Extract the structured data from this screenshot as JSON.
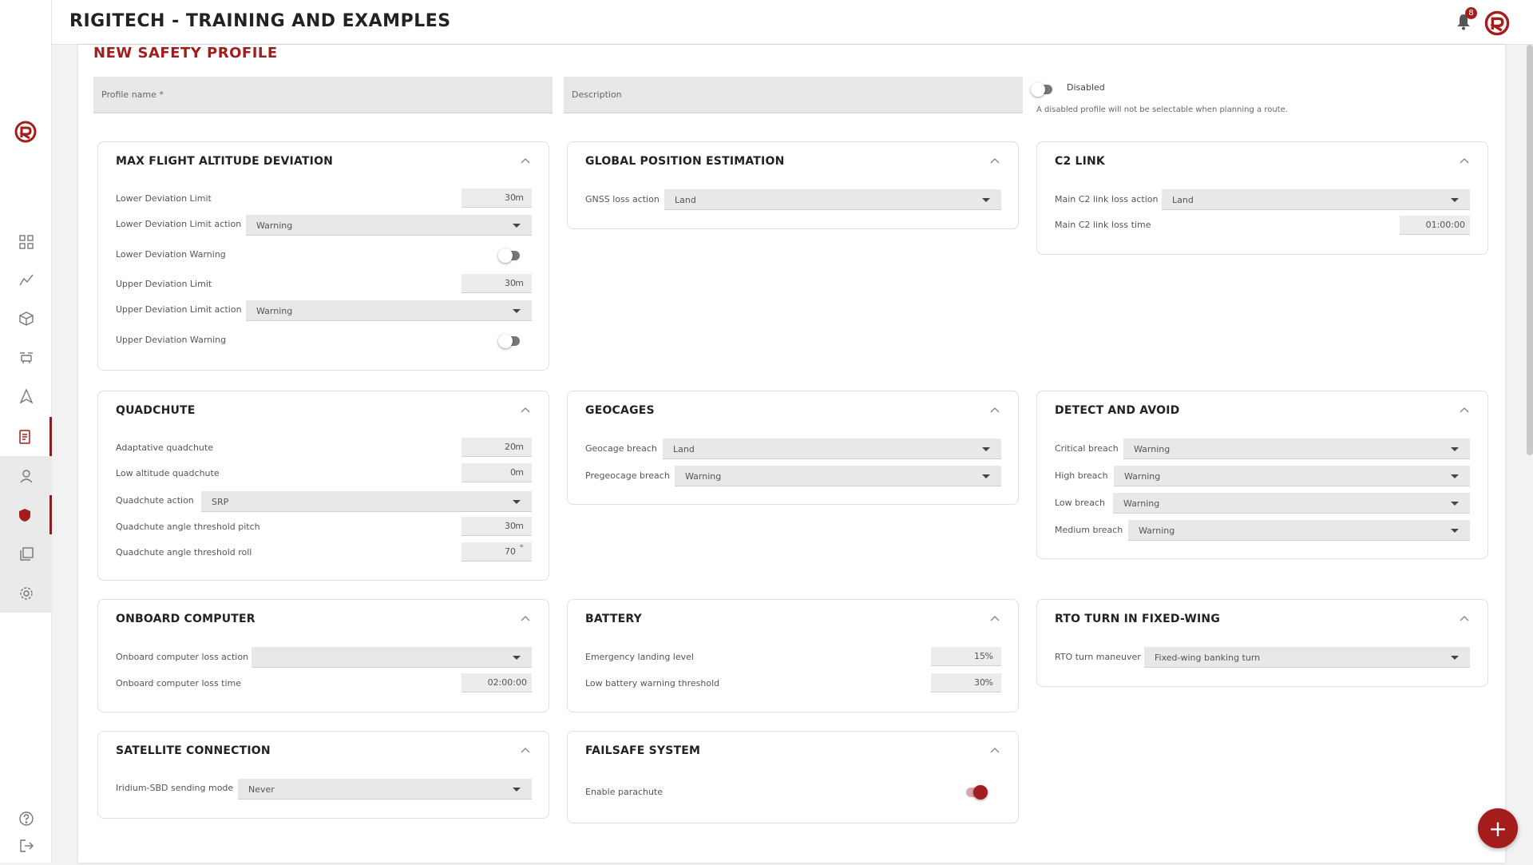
{
  "app": {
    "title": "RIGITECH - TRAINING AND EXAMPLES",
    "notification_count": "8"
  },
  "page": {
    "title": "NEW SAFETY PROFILE",
    "profile_name_placeholder": "Profile name *",
    "description_placeholder": "Description",
    "disabled_label": "Disabled",
    "disabled_hint": "A disabled profile will not be selectable when planning a route."
  },
  "cards": {
    "altitude": {
      "title": "MAX FLIGHT ALTITUDE DEVIATION",
      "lower_limit_label": "Lower Deviation Limit",
      "lower_limit_value": "30",
      "lower_limit_unit": "m",
      "lower_action_label": "Lower Deviation Limit action",
      "lower_action_value": "Warning",
      "lower_warning_label": "Lower Deviation Warning",
      "upper_limit_label": "Upper Deviation Limit",
      "upper_limit_value": "30",
      "upper_limit_unit": "m",
      "upper_action_label": "Upper Deviation Limit action",
      "upper_action_value": "Warning",
      "upper_warning_label": "Upper Deviation Warning"
    },
    "gps": {
      "title": "GLOBAL POSITION ESTIMATION",
      "gnss_label": "GNSS loss action",
      "gnss_value": "Land"
    },
    "c2": {
      "title": "C2 LINK",
      "action_label": "Main C2 link loss action",
      "action_value": "Land",
      "time_label": "Main C2 link loss time",
      "time_value": "01:00:00"
    },
    "quadchute": {
      "title": "QUADCHUTE",
      "adaptive_label": "Adaptative quadchute",
      "adaptive_value": "20",
      "adaptive_unit": "m",
      "low_alt_label": "Low altitude quadchute",
      "low_alt_value": "0",
      "low_alt_unit": "m",
      "action_label": "Quadchute action",
      "action_value": "SRP",
      "pitch_label": "Quadchute angle threshold pitch",
      "pitch_value": "30",
      "pitch_unit": "m",
      "roll_label": "Quadchute angle threshold roll",
      "roll_value": "70",
      "roll_unit": "°"
    },
    "geocages": {
      "title": "GEOCAGES",
      "breach_label": "Geocage breach",
      "breach_value": "Land",
      "pre_label": "Pregeocage breach",
      "pre_value": "Warning"
    },
    "daa": {
      "title": "DETECT AND AVOID",
      "critical_label": "Critical breach",
      "critical_value": "Warning",
      "high_label": "High breach",
      "high_value": "Warning",
      "low_label": "Low breach",
      "low_value": "Warning",
      "medium_label": "Medium breach",
      "medium_value": "Warning"
    },
    "obc": {
      "title": "ONBOARD COMPUTER",
      "action_label": "Onboard computer loss action",
      "action_value": "",
      "time_label": "Onboard computer loss time",
      "time_value": "02:00:00"
    },
    "battery": {
      "title": "BATTERY",
      "emergency_label": "Emergency landing level",
      "emergency_value": "15",
      "emergency_unit": "%",
      "low_label": "Low battery warning threshold",
      "low_value": "30",
      "low_unit": "%"
    },
    "rto": {
      "title": "RTO TURN IN FIXED-WING",
      "maneuver_label": "RTO turn maneuver",
      "maneuver_value": "Fixed-wing banking turn"
    },
    "satellite": {
      "title": "SATELLITE CONNECTION",
      "mode_label": "Iridium-SBD sending mode",
      "mode_value": "Never"
    },
    "failsafe": {
      "title": "FAILSAFE SYSTEM",
      "parachute_label": "Enable parachute",
      "parachute_enabled": true
    }
  },
  "fab": {
    "label": "+"
  },
  "colors": {
    "accent": "#a31d1d",
    "field_bg": "#e8e8e8"
  }
}
